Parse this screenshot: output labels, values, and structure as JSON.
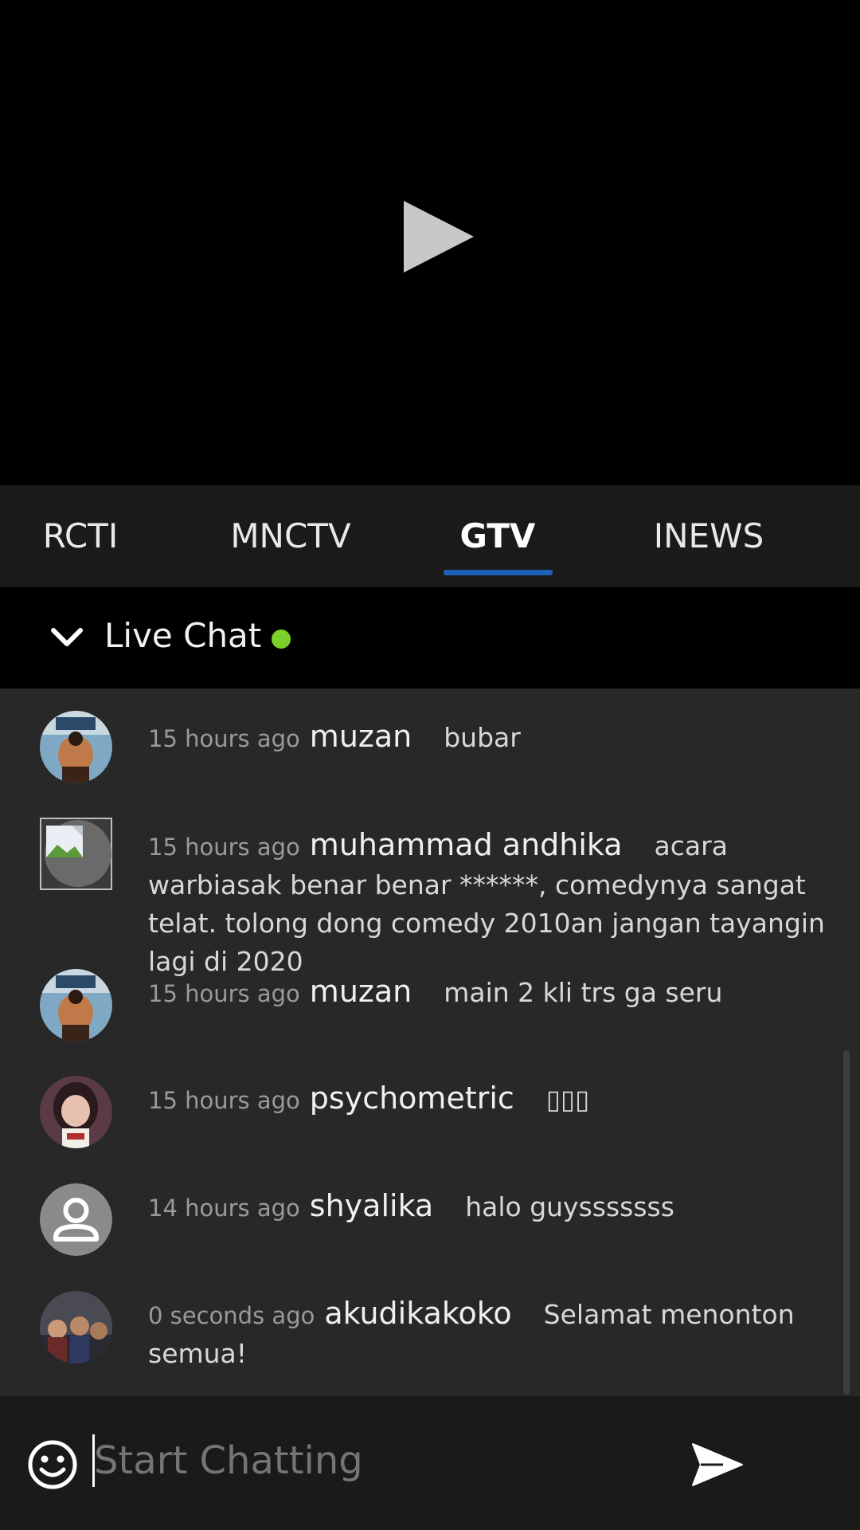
{
  "player": {
    "play_icon": "play-icon"
  },
  "tabs": [
    {
      "label": "RCTI",
      "active": false
    },
    {
      "label": "MNCTV",
      "active": false
    },
    {
      "label": "GTV",
      "active": true
    },
    {
      "label": "INEWS",
      "active": false
    }
  ],
  "chat": {
    "title": "Live Chat",
    "status_color": "#7bd129",
    "messages": [
      {
        "time": "15 hours ago",
        "user": "muzan",
        "text": "bubar",
        "avatar": "anime-avatar"
      },
      {
        "time": "15 hours ago",
        "user": "muhammad andhika",
        "text": "acara warbiasak benar benar ******, comedynya sangat telat. tolong dong comedy 2010an jangan tayangin lagi di 2020",
        "avatar": "broken-image-avatar"
      },
      {
        "time": "15 hours ago",
        "user": "muzan",
        "text": "main 2 kli trs ga seru",
        "avatar": "anime-avatar"
      },
      {
        "time": "15 hours ago",
        "user": "psychometric",
        "text": "▯▯▯",
        "avatar": "photo-avatar"
      },
      {
        "time": "14 hours ago",
        "user": "shyalika",
        "text": "halo guysssssss",
        "avatar": "default-user-avatar"
      },
      {
        "time": "0 seconds ago",
        "user": "akudikakoko",
        "text": "Selamat menonton semua!",
        "avatar": "group-photo-avatar"
      }
    ]
  },
  "input": {
    "placeholder": "Start Chatting",
    "emoji_icon": "emoji-icon",
    "send_icon": "send-icon"
  },
  "colors": {
    "tab_underline": "#1e5fb8",
    "chat_bg": "#282828",
    "bar_bg": "#1a1a1a"
  }
}
